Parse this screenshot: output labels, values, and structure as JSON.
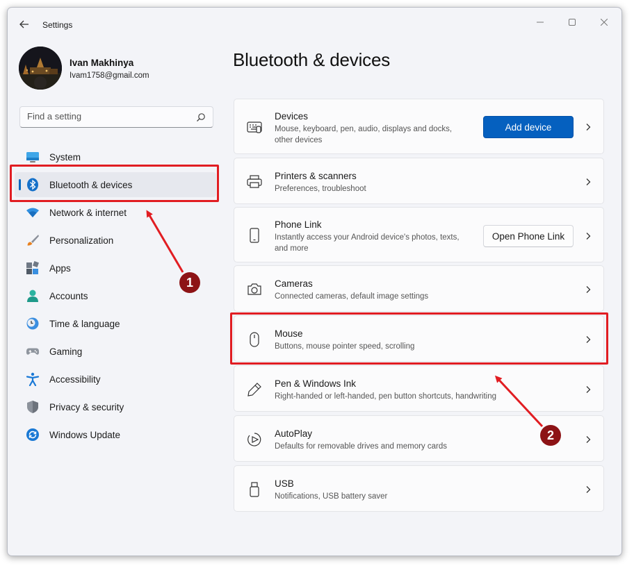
{
  "window": {
    "title": "Settings"
  },
  "profile": {
    "name": "Ivan Makhinya",
    "email": "Ivam1758@gmail.com"
  },
  "search": {
    "placeholder": "Find a setting"
  },
  "nav": [
    {
      "label": "System",
      "icon": "monitor-icon"
    },
    {
      "label": "Bluetooth & devices",
      "icon": "bluetooth-icon",
      "active": true
    },
    {
      "label": "Network & internet",
      "icon": "wifi-icon"
    },
    {
      "label": "Personalization",
      "icon": "brush-icon"
    },
    {
      "label": "Apps",
      "icon": "apps-icon"
    },
    {
      "label": "Accounts",
      "icon": "person-icon"
    },
    {
      "label": "Time & language",
      "icon": "clock-globe-icon"
    },
    {
      "label": "Gaming",
      "icon": "gamepad-icon"
    },
    {
      "label": "Accessibility",
      "icon": "accessibility-icon"
    },
    {
      "label": "Privacy & security",
      "icon": "shield-icon"
    },
    {
      "label": "Windows Update",
      "icon": "update-icon"
    }
  ],
  "page": {
    "title": "Bluetooth & devices"
  },
  "cards": [
    {
      "title": "Devices",
      "desc": "Mouse, keyboard, pen, audio, displays and docks, other devices",
      "icon": "devices-icon",
      "button": "Add device"
    },
    {
      "title": "Printers & scanners",
      "desc": "Preferences, troubleshoot",
      "icon": "printer-icon"
    },
    {
      "title": "Phone Link",
      "desc": "Instantly access your Android device's photos, texts, and more",
      "icon": "phone-icon",
      "button": "Open Phone Link"
    },
    {
      "title": "Cameras",
      "desc": "Connected cameras, default image settings",
      "icon": "camera-icon"
    },
    {
      "title": "Mouse",
      "desc": "Buttons, mouse pointer speed, scrolling",
      "icon": "mouse-icon"
    },
    {
      "title": "Pen & Windows Ink",
      "desc": "Right-handed or left-handed, pen button shortcuts, handwriting",
      "icon": "pen-icon"
    },
    {
      "title": "AutoPlay",
      "desc": "Defaults for removable drives and memory cards",
      "icon": "autoplay-icon"
    },
    {
      "title": "USB",
      "desc": "Notifications, USB battery saver",
      "icon": "usb-icon"
    }
  ],
  "annotations": {
    "badge1": "1",
    "badge2": "2"
  },
  "colors": {
    "accent": "#0560bf",
    "annotation": "#e11d22",
    "badge": "#8d1316"
  }
}
